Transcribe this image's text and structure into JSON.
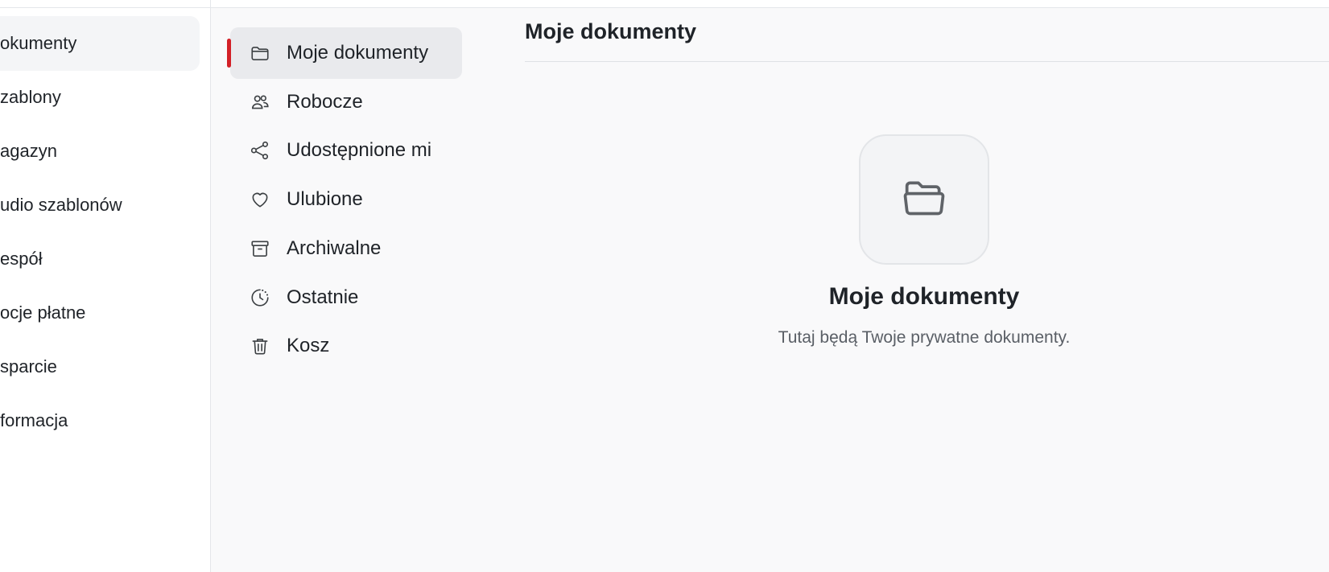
{
  "main_nav": {
    "items": [
      {
        "label": "okumenty",
        "active": true
      },
      {
        "label": "zablony"
      },
      {
        "label": "agazyn"
      },
      {
        "label": "udio szablonów"
      },
      {
        "label": "espół"
      },
      {
        "label": "ocje płatne"
      },
      {
        "label": "sparcie"
      },
      {
        "label": "formacja"
      }
    ]
  },
  "sub_nav": {
    "items": [
      {
        "label": "Moje dokumenty",
        "icon": "folder-icon",
        "active": true
      },
      {
        "label": "Robocze",
        "icon": "users-icon"
      },
      {
        "label": "Udostępnione mi",
        "icon": "share-icon"
      },
      {
        "label": "Ulubione",
        "icon": "heart-icon"
      },
      {
        "label": "Archiwalne",
        "icon": "archive-icon"
      },
      {
        "label": "Ostatnie",
        "icon": "clock-icon"
      },
      {
        "label": "Kosz",
        "icon": "trash-icon"
      }
    ]
  },
  "page": {
    "title": "Moje dokumenty"
  },
  "empty_state": {
    "icon": "folder-open-icon",
    "title": "Moje dokumenty",
    "subtitle": "Tutaj będą Twoje prywatne dokumenty."
  },
  "colors": {
    "accent": "#d32027",
    "active_bg": "#e9eaed",
    "icon": "#5f6368"
  }
}
